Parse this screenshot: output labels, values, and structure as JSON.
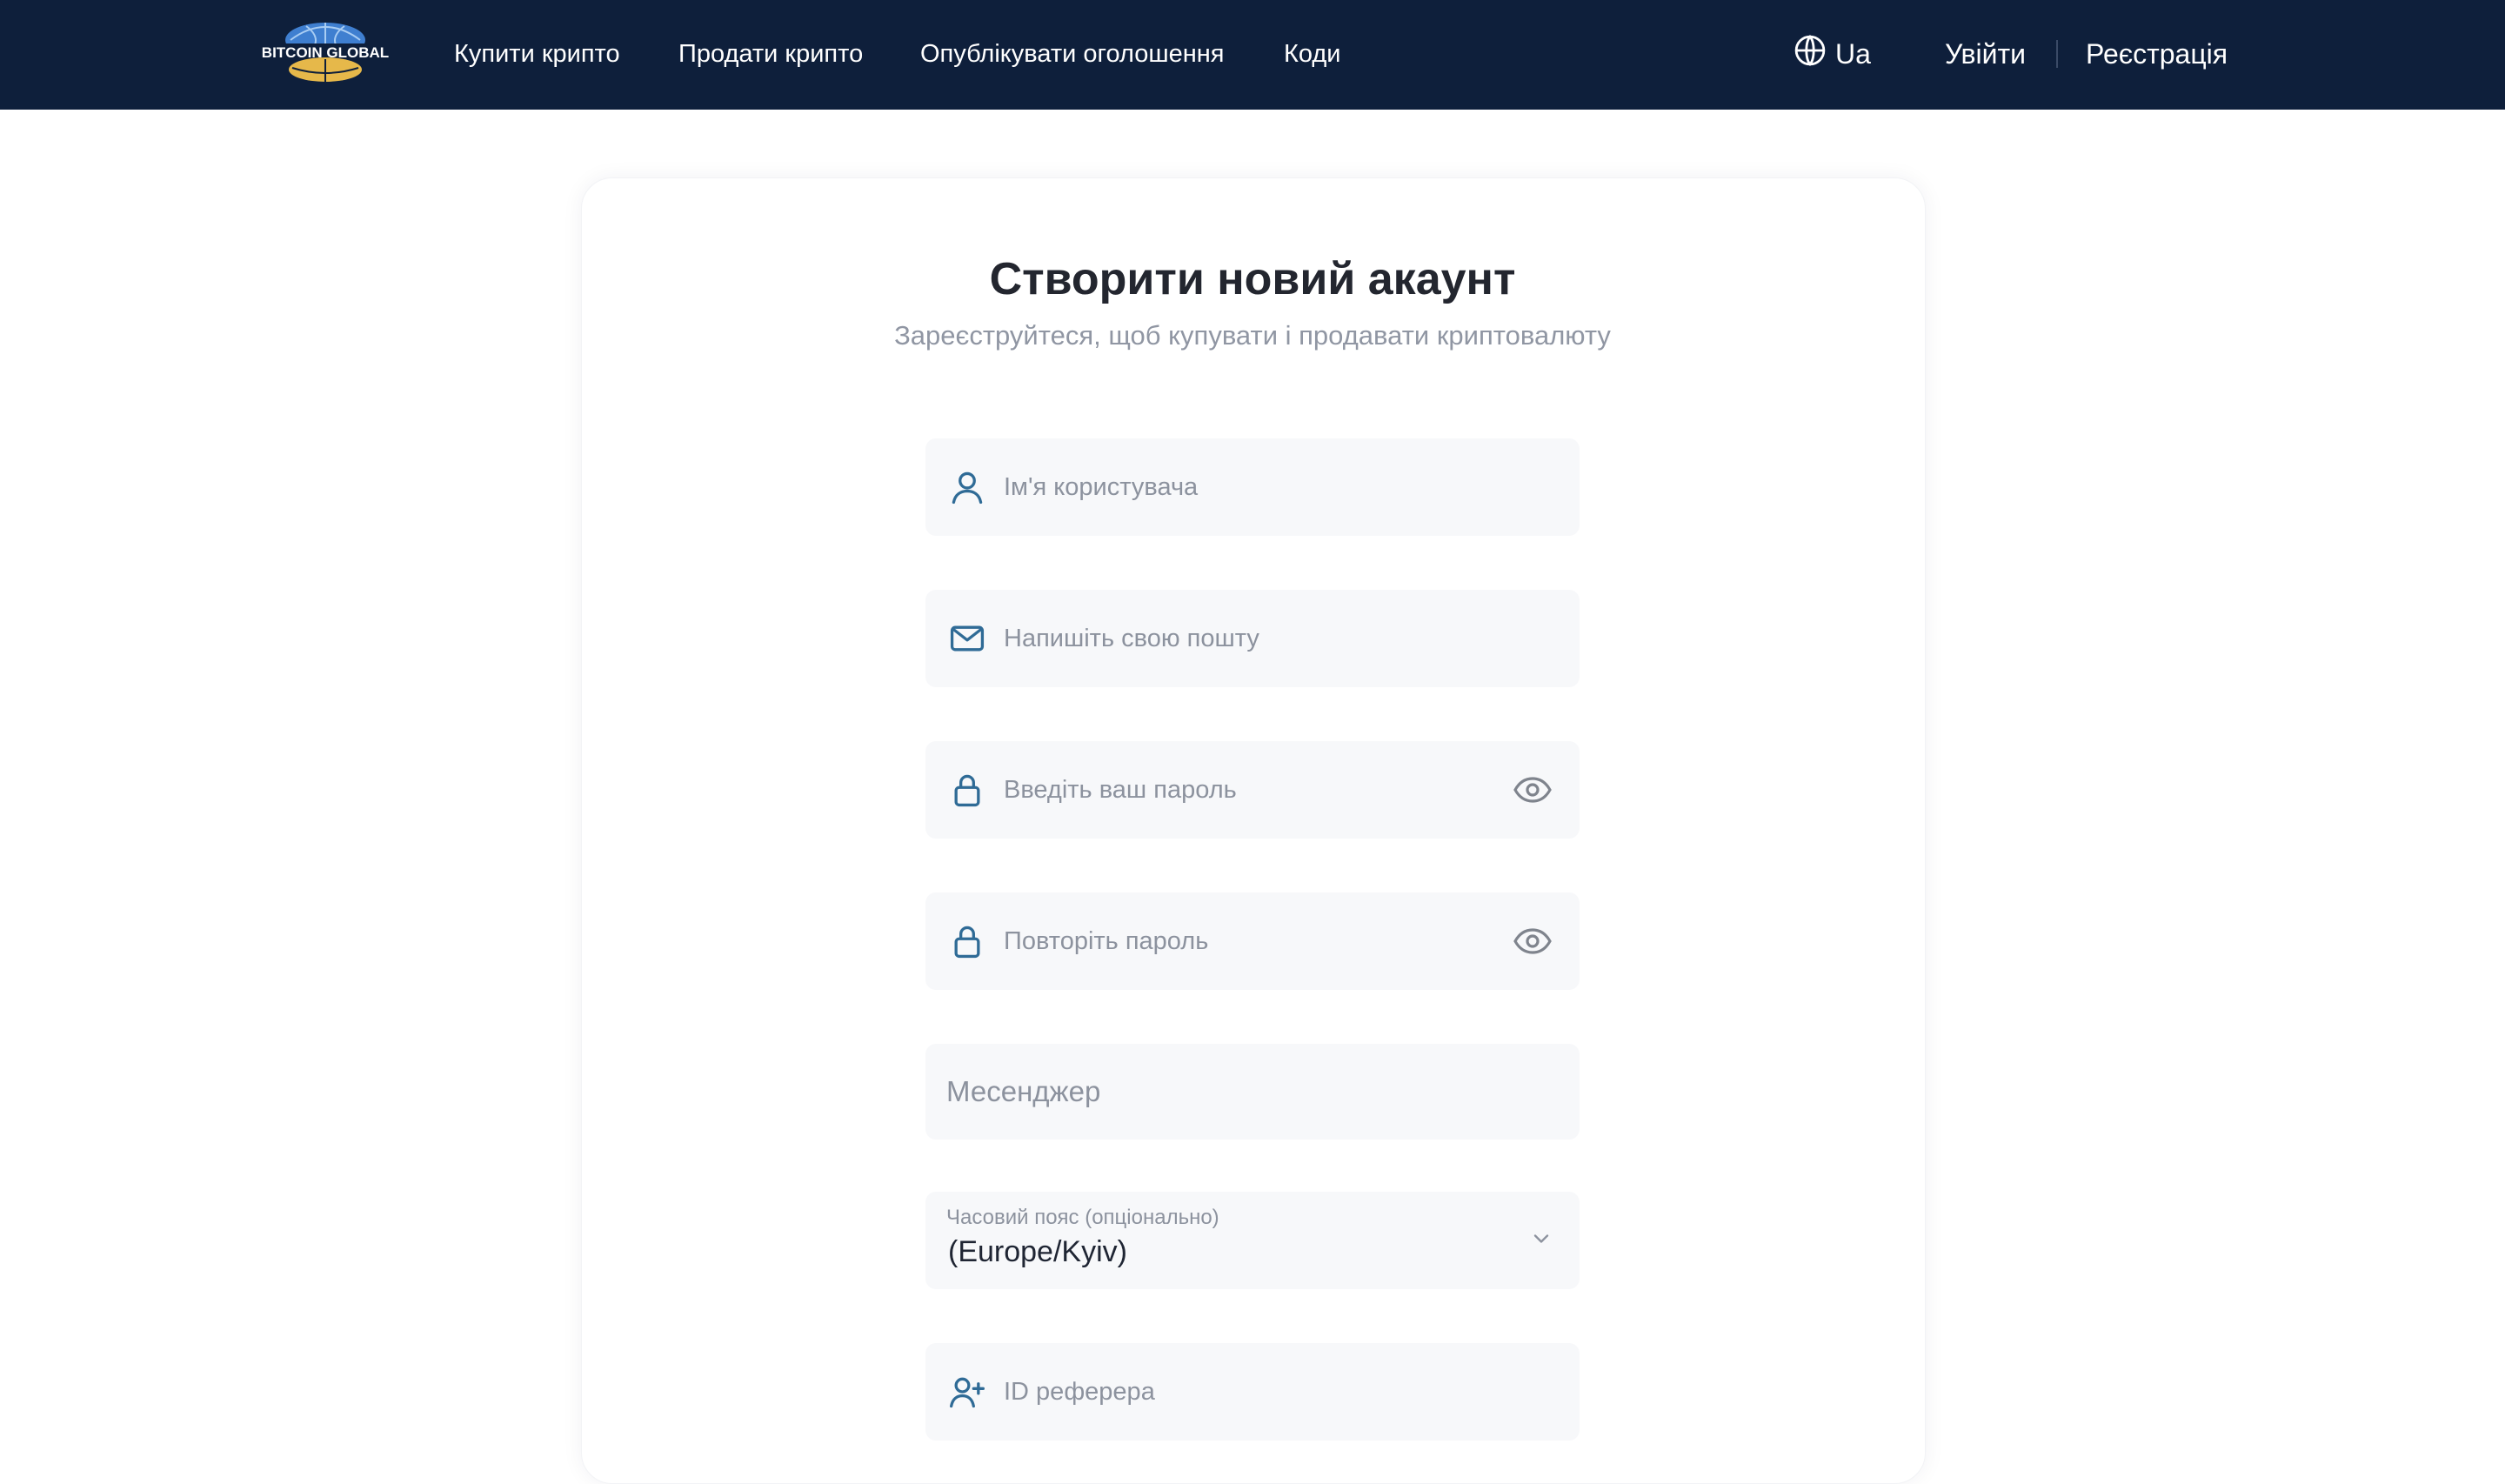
{
  "header": {
    "logo_text": "BITCOIN GLOBAL",
    "nav": [
      {
        "label": "Купити крипто"
      },
      {
        "label": "Продати крипто"
      },
      {
        "label": "Опублікувати оголошення"
      },
      {
        "label": "Коди"
      }
    ],
    "language": "Ua",
    "login": "Увійти",
    "register": "Реєстрація"
  },
  "form": {
    "title": "Створити новий акаунт",
    "subtitle": "Зареєструйтеся, щоб купувати і продавати криптовалюту",
    "username": {
      "placeholder": "Ім'я користувача",
      "value": ""
    },
    "email": {
      "placeholder": "Напишіть свою пошту",
      "value": ""
    },
    "password": {
      "placeholder": "Введіть ваш пароль",
      "value": ""
    },
    "password_repeat": {
      "placeholder": "Повторіть пароль",
      "value": ""
    },
    "messenger": {
      "placeholder": "Месенджер",
      "value": ""
    },
    "timezone": {
      "label": "Часовий пояс (опціонально)",
      "value": "(Europe/Kyiv)"
    },
    "referrer": {
      "placeholder": "ID реферера",
      "value": ""
    }
  },
  "icons": {
    "username": "user-icon",
    "email": "mail-icon",
    "password": "lock-icon",
    "password_toggle": "eye-icon",
    "timezone": "chevron-down-icon",
    "referrer": "user-plus-icon",
    "language": "globe-icon"
  },
  "colors": {
    "header_bg": "#0e1f3b",
    "field_bg": "#f7f8fa",
    "icon_accent": "#2f6b96",
    "logo_gold": "#e6b84a",
    "logo_blue": "#3f7fd0"
  }
}
